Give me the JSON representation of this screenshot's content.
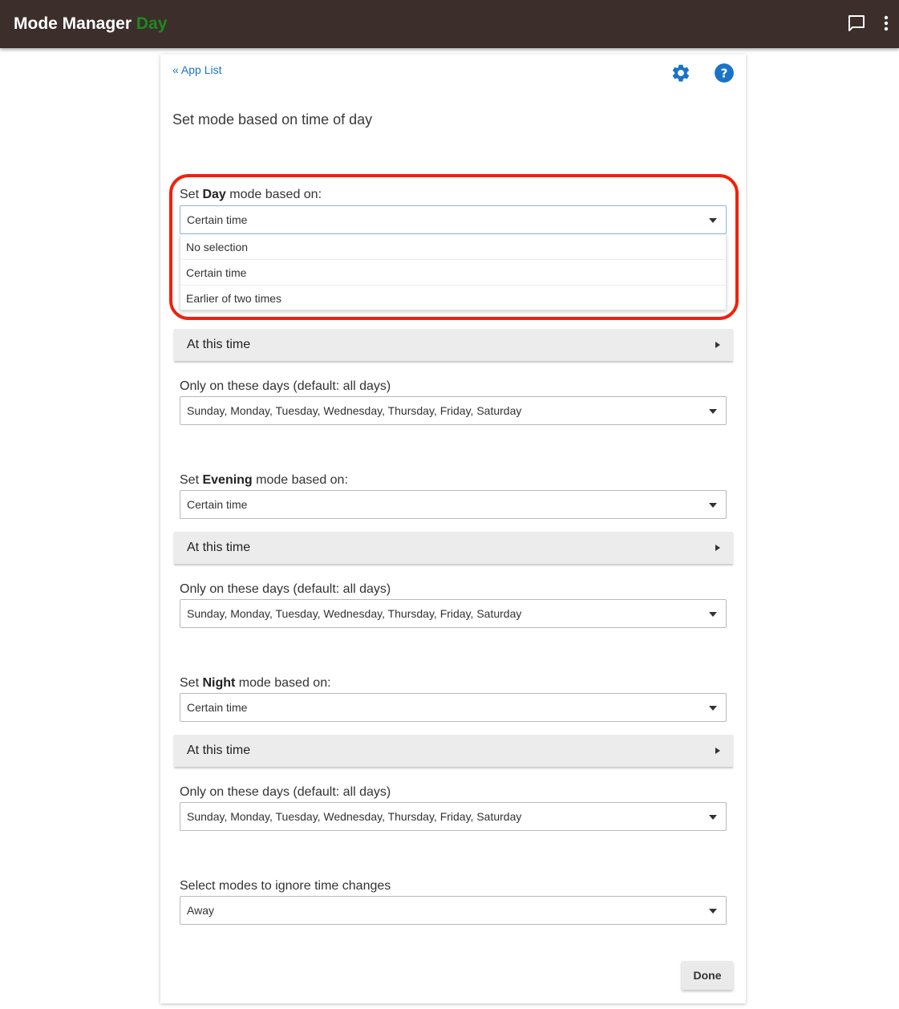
{
  "header": {
    "app_title": "Mode Manager",
    "current_mode": "Day",
    "chat_icon": "chat-bubble-icon",
    "menu_icon": "more-vertical-icon"
  },
  "card": {
    "back_link": "« App List",
    "settings_icon": "gear-icon",
    "help_icon": "help-circle-icon",
    "page_title": "Set mode based on time of day"
  },
  "day": {
    "label_pre": "Set ",
    "label_bold": "Day",
    "label_post": " mode based on:",
    "select_value": "Certain time",
    "dropdown_options": [
      "No selection",
      "Certain time",
      "Earlier of two times"
    ],
    "time_section": "At this time",
    "days_label": "Only on these days (default: all days)",
    "days_value": "Sunday, Monday, Tuesday, Wednesday, Thursday, Friday, Saturday"
  },
  "evening": {
    "label_pre": "Set ",
    "label_bold": "Evening",
    "label_post": " mode based on:",
    "select_value": "Certain time",
    "time_section": "At this time",
    "days_label": "Only on these days (default: all days)",
    "days_value": "Sunday, Monday, Tuesday, Wednesday, Thursday, Friday, Saturday"
  },
  "night": {
    "label_pre": "Set ",
    "label_bold": "Night",
    "label_post": " mode based on:",
    "select_value": "Certain time",
    "time_section": "At this time",
    "days_label": "Only on these days (default: all days)",
    "days_value": "Sunday, Monday, Tuesday, Wednesday, Thursday, Friday, Saturday"
  },
  "ignore": {
    "label": "Select modes to ignore time changes",
    "select_value": "Away"
  },
  "done_label": "Done",
  "colors": {
    "topbar": "#3b2e2b",
    "mode_name": "#1e8a1e",
    "link": "#1a73c8",
    "highlight": "#f0220c"
  }
}
